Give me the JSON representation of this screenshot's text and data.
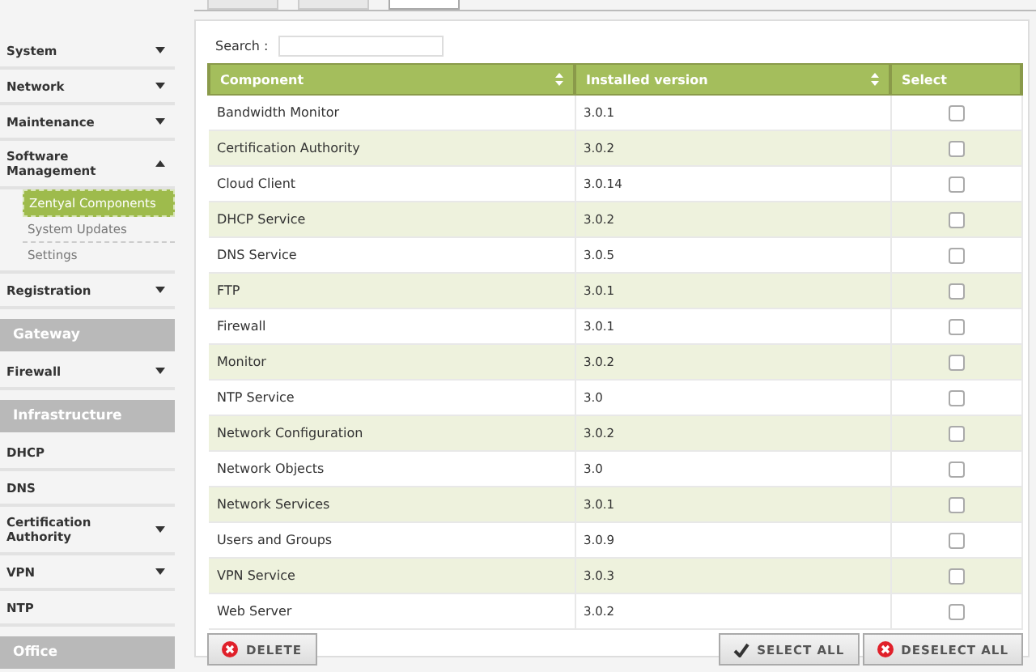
{
  "tabs": [
    {
      "selected": false
    },
    {
      "selected": false
    },
    {
      "selected": true
    }
  ],
  "sidebar": {
    "items": [
      {
        "kind": "menu",
        "label": "System",
        "expanded": false
      },
      {
        "kind": "menu",
        "label": "Network",
        "expanded": false
      },
      {
        "kind": "menu",
        "label": "Maintenance",
        "expanded": false
      },
      {
        "kind": "menu",
        "label": "Software Management",
        "expanded": true,
        "children": [
          {
            "label": "Zentyal Components",
            "selected": true
          },
          {
            "label": "System Updates",
            "selected": false
          },
          {
            "label": "Settings",
            "selected": false
          }
        ]
      },
      {
        "kind": "menu",
        "label": "Registration",
        "expanded": false
      },
      {
        "kind": "header",
        "label": "Gateway"
      },
      {
        "kind": "menu",
        "label": "Firewall",
        "expanded": false
      },
      {
        "kind": "header",
        "label": "Infrastructure"
      },
      {
        "kind": "link",
        "label": "DHCP"
      },
      {
        "kind": "link",
        "label": "DNS"
      },
      {
        "kind": "menu",
        "label": "Certification Authority",
        "expanded": false
      },
      {
        "kind": "menu",
        "label": "VPN",
        "expanded": false
      },
      {
        "kind": "link",
        "label": "NTP"
      },
      {
        "kind": "header",
        "label": "Office"
      }
    ]
  },
  "search": {
    "label": "Search :"
  },
  "table": {
    "columns": [
      {
        "label": "Component",
        "sortable": true
      },
      {
        "label": "Installed version",
        "sortable": true
      },
      {
        "label": "Select",
        "sortable": false
      }
    ],
    "rows": [
      {
        "component": "Bandwidth Monitor",
        "version": "3.0.1",
        "checked": false
      },
      {
        "component": "Certification Authority",
        "version": "3.0.2",
        "checked": false
      },
      {
        "component": "Cloud Client",
        "version": "3.0.14",
        "checked": false
      },
      {
        "component": "DHCP Service",
        "version": "3.0.2",
        "checked": false
      },
      {
        "component": "DNS Service",
        "version": "3.0.5",
        "checked": false
      },
      {
        "component": "FTP",
        "version": "3.0.1",
        "checked": false
      },
      {
        "component": "Firewall",
        "version": "3.0.1",
        "checked": false
      },
      {
        "component": "Monitor",
        "version": "3.0.2",
        "checked": false
      },
      {
        "component": "NTP Service",
        "version": "3.0",
        "checked": false
      },
      {
        "component": "Network Configuration",
        "version": "3.0.2",
        "checked": false
      },
      {
        "component": "Network Objects",
        "version": "3.0",
        "checked": false
      },
      {
        "component": "Network Services",
        "version": "3.0.1",
        "checked": false
      },
      {
        "component": "Users and Groups",
        "version": "3.0.9",
        "checked": false
      },
      {
        "component": "VPN Service",
        "version": "3.0.3",
        "checked": false
      },
      {
        "component": "Web Server",
        "version": "3.0.2",
        "checked": false
      }
    ]
  },
  "buttons": {
    "delete": "DELETE",
    "select_all": "SELECT ALL",
    "deselect_all": "DESELECT ALL"
  }
}
